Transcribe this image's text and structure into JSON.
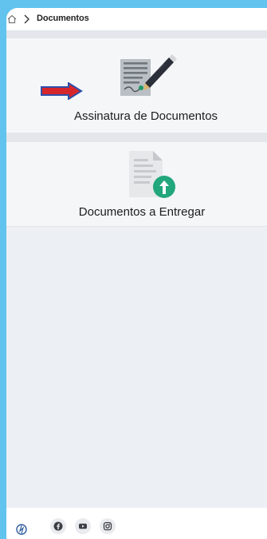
{
  "breadcrumb": {
    "home_icon": "home-icon",
    "separator_icon": "chevron-right-icon",
    "current": "Documentos"
  },
  "cards": [
    {
      "label": "Assinatura de Documentos",
      "icon": "document-sign-icon"
    },
    {
      "label": "Documentos a Entregar",
      "icon": "document-upload-icon"
    }
  ],
  "annotation": {
    "icon": "red-arrow-icon",
    "color": "#d7262b"
  },
  "footer": {
    "logo_icon": "logo-icon",
    "social": [
      "facebook-icon",
      "youtube-icon",
      "instagram-icon"
    ]
  },
  "colors": {
    "background": "#62c3ee",
    "panel": "#eceff3",
    "card": "#f4f6f8",
    "accent_green": "#22a67c"
  }
}
